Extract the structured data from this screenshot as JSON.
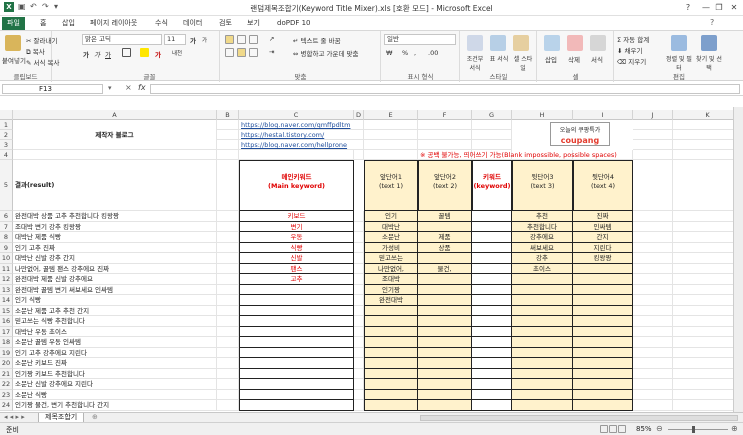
{
  "window": {
    "title": "랜덤제목조합기(Keyword Title Mixer).xls [호환 모드] - Microsoft Excel",
    "help_label": "?",
    "minimize_label": "—",
    "restore_label": "❐",
    "close_label": "✕"
  },
  "tabs": [
    "파일",
    "홈",
    "삽입",
    "페이지 레이아웃",
    "수식",
    "데이터",
    "검토",
    "보기",
    "doPDF 10"
  ],
  "ribbon": {
    "clipboard": {
      "paste": "붙여넣기",
      "cut": "잘라내기",
      "copy": "복사",
      "format_painter": "서식 복사",
      "label": "클립보드"
    },
    "font": {
      "name": "맑은 고딕",
      "size": "11",
      "label": "글꼴",
      "bold": "가",
      "italic": "가",
      "underline": "가",
      "grow": "가",
      "shrink": "가",
      "font_color": "가",
      "phonetic": "내천"
    },
    "alignment": {
      "wrap": "텍스트 줄 바꿈",
      "merge": "병합하고 가운데 맞춤",
      "label": "맞춤"
    },
    "number": {
      "format": "일반",
      "percent": "%",
      "comma": ",",
      "label": "표시 형식"
    },
    "styles": {
      "conditional": "조건부 서식",
      "table": "표 서식",
      "cell": "셀 스타일",
      "label": "스타일"
    },
    "cells": {
      "insert": "삽입",
      "delete": "삭제",
      "format": "서식",
      "label": "셀"
    },
    "editing": {
      "autosum": "자동 합계",
      "fill": "채우기",
      "clear": "지우기",
      "sort": "정렬 및 필터",
      "find": "찾기 및 선택",
      "label": "편집"
    }
  },
  "formula_bar": {
    "name_box": "F13",
    "fx": "fx",
    "value": ""
  },
  "columns": [
    "A",
    "B",
    "C",
    "D",
    "E",
    "F",
    "G",
    "H",
    "I",
    "J",
    "K"
  ],
  "sheet": {
    "blog_title": "제작자 블로그",
    "links": [
      "https://blog.naver.com/qmffpdltm",
      "https://hestal.tistory.com/",
      "https://blog.naver.com/hellprone"
    ],
    "note": "※ 공백 불가능, 띄어쓰기 가능(Blank impossible, possible spaces)",
    "coupang_line1": "오늘의 쿠팡특가",
    "coupang_line2": "coupang",
    "result_header": "결과(result)",
    "main_keyword_header": "메인키워드\n(Main keyword)",
    "text1_header": "앞단어1\n(text 1)",
    "text2_header": "앞단어2\n(text 2)",
    "keyword_header": "키워드\n(keyword)",
    "text3_header": "뒷단어3\n(text 3)",
    "text4_header": "뒷단어4\n(text 4)",
    "results": [
      "완전대박 상품 고추 추천합니다 킹왕짱",
      "조대박  변기 강추 킹왕짱",
      "대박난 제품 식빵",
      "인기  고추  진짜",
      "대박난  신발 강추 간지",
      "나만없어, 꿀템 팬스 강추에요 진짜",
      "완전대박 제품 신발 강추에요",
      "완전대박 꿀템 변기 써보세요 인싸템",
      "인기  식빵",
      "소문난 제품 고추 추천 간지",
      "믿고쓰는  식빵 추천합니다",
      "대박난  우동 초이스",
      "소문난 꿀템 우동  인싸템",
      "인기  고추 강추에요 지린다",
      "소문난  키보드  진짜",
      "인기짱  키보드 추천합니다",
      "소문난  신발 강추에요 지린다",
      "소문난  식빵",
      "인기짱 물건, 변기 추천합니다 간지"
    ],
    "main_keywords": [
      "키보드",
      "변기",
      "우동",
      "식빵",
      "신발",
      "팬스",
      "고추"
    ],
    "text1": [
      "인기",
      "대박난",
      "소문난",
      "가성비",
      "믿고쓰는",
      "나만없어,",
      "조대박",
      "인기짱",
      "완전대박"
    ],
    "text2": [
      "꿀템",
      "",
      "제품",
      "상품",
      "",
      "물건,"
    ],
    "text3": [
      "추천",
      "추천합니다",
      "강추에요",
      "써보세요",
      "강추",
      "초이스"
    ],
    "text4": [
      "진짜",
      "인싸템",
      "간지",
      "지린다",
      "킹왕짱"
    ]
  },
  "sheet_tabs": {
    "active": "제목조합기"
  },
  "status": {
    "ready": "준비",
    "zoom": "85%"
  }
}
